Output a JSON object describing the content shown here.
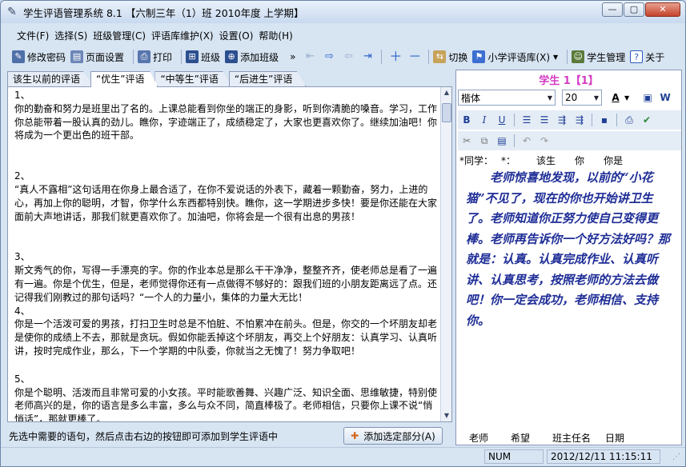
{
  "window": {
    "title": "学生评语管理系统 8.1 【六制三年（1）班  2010年度 上学期】",
    "controls": {
      "minimize": "—",
      "maximize": "▢",
      "close": "✕"
    }
  },
  "menu": [
    "文件(F)",
    "选择(S)",
    "班级管理(C)",
    "评语库维护(X)",
    "设置(O)",
    "帮助(H)"
  ],
  "toolbar": {
    "change_password": "修改密码",
    "page_setup": "页面设置",
    "print": "打印",
    "class": "班级",
    "add_class": "添加班级",
    "more": "»",
    "switch": "切换",
    "library_dropdown": "小学评语库(X)",
    "student_management": "学生管理",
    "about": "关于"
  },
  "tabs": [
    "该生以前的评语",
    "“优生”评语",
    "“中等生”评语",
    "“后进生”评语"
  ],
  "active_tab_index": 1,
  "comments": [
    {
      "num": "1、",
      "text": "你的勤奋和努力是班里出了名的。上课总能看到你坐的端正的身影，听到你清脆的嗓音。学习，工作你总能带着一股认真的劲儿。瞧你，字迹端正了，成绩稳定了，大家也更喜欢你了。继续加油吧！你将成为一个更出色的班干部。"
    },
    {
      "num": "2、",
      "text": "“真人不露相”这句话用在你身上最合适了，在你不爱说话的外表下，藏着一颗勤奋，努力，上进的心，再加上你的聪明，才智，你学什么东西都特别快。瞧你，这一学期进步多快！要是你还能在大家面前大声地讲话，那我们就更喜欢你了。加油吧，你将会是一个很有出息的男孩！"
    },
    {
      "num": "3、",
      "text": "斯文秀气的你，写得一手漂亮的字。你的作业本总是那么干干净净，整整齐齐，使老师总是看了一遍有一遍。你是个优生，但是，老师觉得你还有一点做得不够好的：跟我们班的小朋友距离远了点。还记得我们刚教过的那句话吗？“一个人的力量小，集体的力量大无比！"
    },
    {
      "num": "4、",
      "text": "你是一个活泼可爱的男孩，打扫卫生时总是不怕脏、不怕累冲在前头。但是，你交的一个坏朋友却老是使你的成绩上不去，那就是贪玩。假如你能丢掉这个坏朋友，再交上个好朋友：认真学习、认真听讲，按时完成作业，那么，下一个学期的中队委，你就当之无愧了！努力争取吧！"
    },
    {
      "num": "5、",
      "text": "你是个聪明、活泼而且非常可爱的小女孩。平时能歌善舞、兴趣广泛、知识全面、思维敏捷，特别使老师高兴的是，你的语言是多么丰富，多么与众不同，简直棒极了。老师相信，只要你上课不说“悄悄话”，那就更棒了。"
    }
  ],
  "hint": "先选中需要的语句，然后点击右边的按钮即可添加到学生评语中",
  "add_selected_button": "添加选定部分(A)",
  "right": {
    "student_title": "学生 1【1】",
    "font_name": "楷体",
    "font_size": "20",
    "color_a": "A",
    "placeholders": [
      "*同学：",
      "*：",
      "该生",
      "你",
      "你是"
    ],
    "editor_text": "老师惊喜地发现，以前的“小花猫”不见了，现在的你也开始讲卫生了。老师知道你正努力使自己变得更棒。老师再告诉你一个好方法好吗？那就是：认真。认真完成作业、认真听讲、认真思考，按照老师的方法去做吧！你一定会成功，老师相信、支持你。",
    "bottom_fields": [
      "老师",
      "希望",
      "班主任名",
      "日期"
    ]
  },
  "status": {
    "num": "NUM",
    "datetime": "2012/12/11 11:15:11"
  },
  "colors": {
    "student_title": "#d43bc4",
    "editor_text": "#1e2d96",
    "accent_blue": "#2a62c9"
  },
  "icons": [
    "app-feather-icon",
    "password-icon",
    "page-setup-icon",
    "print-icon",
    "class-icon",
    "add-class-icon",
    "nav-first-icon",
    "nav-prev-icon",
    "nav-next-icon",
    "nav-last-icon",
    "plus-icon",
    "minus-icon",
    "switch-icon",
    "library-icon",
    "student-manage-icon",
    "help-icon",
    "word-icon",
    "w-icon",
    "bold-icon",
    "italic-icon",
    "underline-icon",
    "align-icon",
    "save-icon",
    "print-small-icon",
    "check-icon",
    "cut-icon",
    "copy-icon",
    "paste-icon",
    "undo-icon",
    "redo-icon"
  ]
}
